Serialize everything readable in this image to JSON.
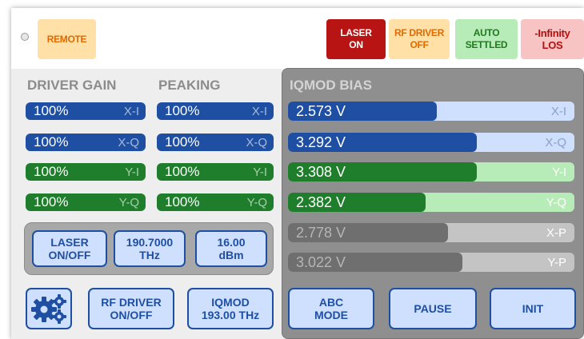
{
  "status_bar": {
    "remote": "REMOTE",
    "laser": [
      "LASER",
      "ON"
    ],
    "rf_driver": [
      "RF DRIVER",
      "OFF"
    ],
    "auto": [
      "AUTO",
      "SETTLED"
    ],
    "los": [
      "-Infinity",
      "LOS"
    ]
  },
  "driver_gain": {
    "header": "DRIVER GAIN",
    "rows": [
      {
        "value": "100%",
        "suffix": "X-I"
      },
      {
        "value": "100%",
        "suffix": "X-Q"
      },
      {
        "value": "100%",
        "suffix": "Y-I"
      },
      {
        "value": "100%",
        "suffix": "Y-Q"
      }
    ]
  },
  "peaking": {
    "header": "PEAKING",
    "rows": [
      {
        "value": "100%",
        "suffix": "X-I"
      },
      {
        "value": "100%",
        "suffix": "X-Q"
      },
      {
        "value": "100%",
        "suffix": "Y-I"
      },
      {
        "value": "100%",
        "suffix": "Y-Q"
      }
    ]
  },
  "iqmod_bias": {
    "header": "IQMOD BIAS",
    "rows": [
      {
        "value": "2.573 V",
        "suffix": "X-I",
        "level": 0.52
      },
      {
        "value": "3.292 V",
        "suffix": "X-Q",
        "level": 0.66
      },
      {
        "value": "3.308 V",
        "suffix": "Y-I",
        "level": 0.66
      },
      {
        "value": "2.382 V",
        "suffix": "Y-Q",
        "level": 0.48
      },
      {
        "value": "2.778 V",
        "suffix": "X-P",
        "level": 0.56
      },
      {
        "value": "3.022 V",
        "suffix": "Y-P",
        "level": 0.61
      }
    ]
  },
  "buttons": {
    "laser_onoff": [
      "LASER",
      "ON/OFF"
    ],
    "frequency": [
      "190.7000",
      "THz"
    ],
    "power": [
      "16.00",
      "dBm"
    ],
    "rf_driver_onoff": [
      "RF DRIVER",
      "ON/OFF"
    ],
    "iqmod": [
      "IQMOD",
      "193.00 THz"
    ],
    "abc_mode": [
      "ABC",
      "MODE"
    ],
    "pause": "PAUSE",
    "init": "INIT"
  },
  "colors": {
    "blue": "#1f4fa2",
    "green": "#1f7e2b",
    "gray_fill": "#6f6f6f",
    "laser_on": "#b81414"
  }
}
